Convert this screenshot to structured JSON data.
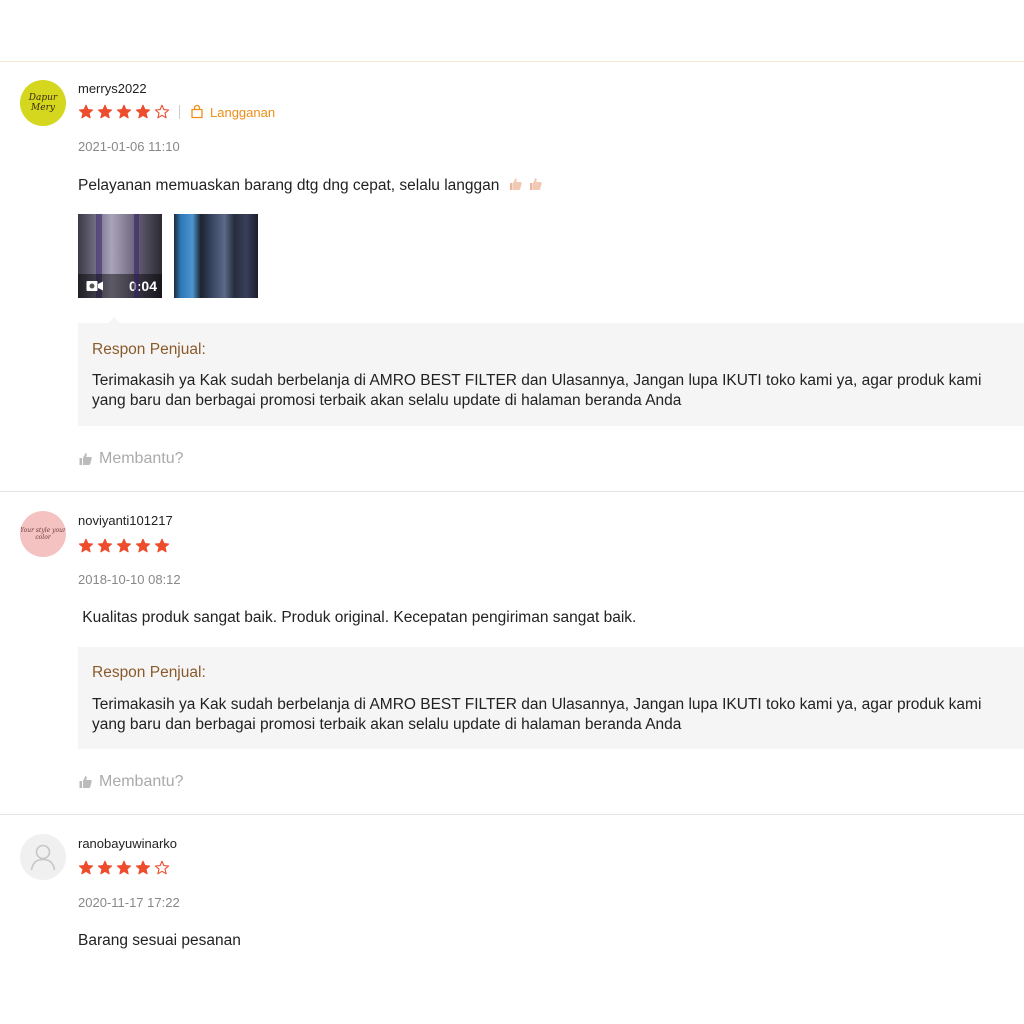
{
  "colors": {
    "star": "#ee4d2d",
    "variant": "#ee8f17",
    "reply_title": "#8a5a2b",
    "muted": "#888888"
  },
  "reviews": [
    {
      "username": "merrys2022",
      "rating": 4,
      "avatar_text": "Dapur Mery",
      "variant_icon": "shopping-bag-icon",
      "variant_label": "Langganan",
      "datetime": "2021-01-06 11:10",
      "comment": "Pelayanan memuaskan barang dtg dng cepat, selalu langgan",
      "comment_emojis": [
        "thumbs-up-icon",
        "thumbs-up-icon"
      ],
      "media": [
        {
          "type": "video",
          "duration": "0:04",
          "icon": "video-camera-icon"
        },
        {
          "type": "photo"
        }
      ],
      "reply_title": "Respon Penjual:",
      "reply_body": "Terimakasih ya Kak sudah berbelanja di AMRO BEST FILTER dan Ulasannya, Jangan lupa IKUTI toko kami ya, agar produk kami yang baru dan berbagai promosi terbaik akan selalu update di halaman beranda Anda",
      "helpful_label": "Membantu?"
    },
    {
      "username": "noviyanti101217",
      "rating": 5,
      "avatar_text": "Your style your color",
      "datetime": "2018-10-10 08:12",
      "comment": " Kualitas produk sangat baik. Produk original. Kecepatan pengiriman sangat baik.",
      "reply_title": "Respon Penjual:",
      "reply_body": "Terimakasih ya Kak sudah berbelanja di AMRO BEST FILTER dan Ulasannya, Jangan lupa IKUTI toko kami ya, agar produk kami yang baru dan berbagai promosi terbaik akan selalu update di halaman beranda Anda",
      "helpful_label": "Membantu?"
    },
    {
      "username": "ranobayuwinarko",
      "rating": 4,
      "avatar_icon": "default-user-icon",
      "datetime": "2020-11-17 17:22",
      "comment": "Barang sesuai pesanan"
    }
  ]
}
